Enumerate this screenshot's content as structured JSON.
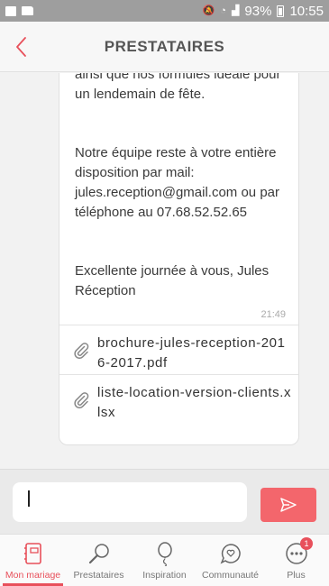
{
  "status_bar": {
    "battery": "93%",
    "time": "10:55"
  },
  "header": {
    "title": "PRESTATAIRES"
  },
  "message": {
    "paragraphs": [
      "ainsi que nos formules idéale pour un lendemain de fête.",
      "Notre équipe reste à votre entière disposition par mail: jules.reception@gmail.com ou par téléphone au 07.68.52.52.65",
      "Excellente journée à vous, Jules Réception"
    ],
    "time": "21:49",
    "attachments": [
      {
        "name": "brochure-jules-reception-2016-2017.pdf",
        "icon": "paperclip-icon"
      },
      {
        "name": "liste-location-version-clients.xlsx",
        "icon": "paperclip-icon"
      }
    ]
  },
  "composer": {
    "value": "",
    "placeholder": ""
  },
  "tabs": [
    {
      "label": "Mon mariage",
      "icon": "notebook-icon",
      "active": true
    },
    {
      "label": "Prestataires",
      "icon": "magnifier-icon",
      "active": false
    },
    {
      "label": "Inspiration",
      "icon": "balloon-icon",
      "active": false
    },
    {
      "label": "Communauté",
      "icon": "chat-heart-icon",
      "active": false
    },
    {
      "label": "Plus",
      "icon": "more-icon",
      "active": false,
      "badge": "1"
    }
  ],
  "colors": {
    "accent": "#e8505b",
    "send_button": "#f3666c",
    "status_bar": "#9e9e9e"
  }
}
